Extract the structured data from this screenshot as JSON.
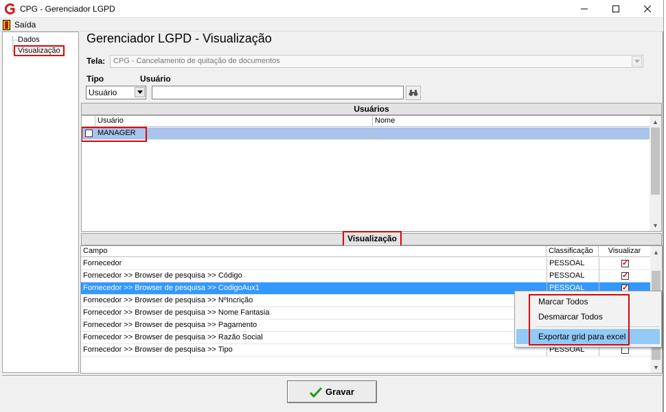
{
  "window": {
    "title": "CPG - Gerenciador LGPD"
  },
  "menu": {
    "exit_label": "Saída"
  },
  "tree": {
    "items": [
      {
        "label": "Dados"
      },
      {
        "label": "Visualização"
      }
    ]
  },
  "page": {
    "title": "Gerenciador LGPD - Visualização"
  },
  "form": {
    "tela_label": "Tela:",
    "tela_value": "CPG - Cancelamento de quitação de documentos",
    "tipo_label": "Tipo",
    "tipo_value": "Usuário",
    "usuario_label": "Usuário",
    "usuario_value": ""
  },
  "users_panel": {
    "title": "Usuários",
    "columns": [
      "Usuário",
      "Nome"
    ],
    "rows": [
      {
        "usuario": "MANAGER",
        "nome": "",
        "checked": false
      }
    ]
  },
  "view_panel": {
    "title": "Visualização",
    "columns": [
      "Campo",
      "Classificação",
      "Visualizar"
    ],
    "rows": [
      {
        "campo": "Fornecedor",
        "classificacao": "PESSOAL",
        "visualizar": true
      },
      {
        "campo": "Fornecedor >> Browser de pesquisa >> Código",
        "classificacao": "PESSOAL",
        "visualizar": true
      },
      {
        "campo": "Fornecedor >> Browser de pesquisa >> CodigoAux1",
        "classificacao": "PESSOAL",
        "visualizar": true
      },
      {
        "campo": "Fornecedor >> Browser de pesquisa >> NºIncrição",
        "classificacao": "",
        "visualizar": false
      },
      {
        "campo": "Fornecedor >> Browser de pesquisa >> Nome Fantasia",
        "classificacao": "",
        "visualizar": false
      },
      {
        "campo": "Fornecedor >> Browser de pesquisa >> Pagamento",
        "classificacao": "",
        "visualizar": false
      },
      {
        "campo": "Fornecedor >> Browser de pesquisa >> Razão Social",
        "classificacao": "",
        "visualizar": false
      },
      {
        "campo": "Fornecedor >> Browser de pesquisa >> Tipo",
        "classificacao": "PESSOAL",
        "visualizar": false
      }
    ]
  },
  "context_menu": {
    "items": [
      {
        "label": "Marcar Todos"
      },
      {
        "label": "Desmarcar Todos"
      },
      {
        "label": "Exportar grid para excel"
      }
    ]
  },
  "footer": {
    "save_label": "Gravar"
  },
  "colors": {
    "highlight": "#e00000",
    "selection": "#3399ff",
    "users_selection": "#a9c4ec",
    "menu_hover": "#91c9f7"
  }
}
